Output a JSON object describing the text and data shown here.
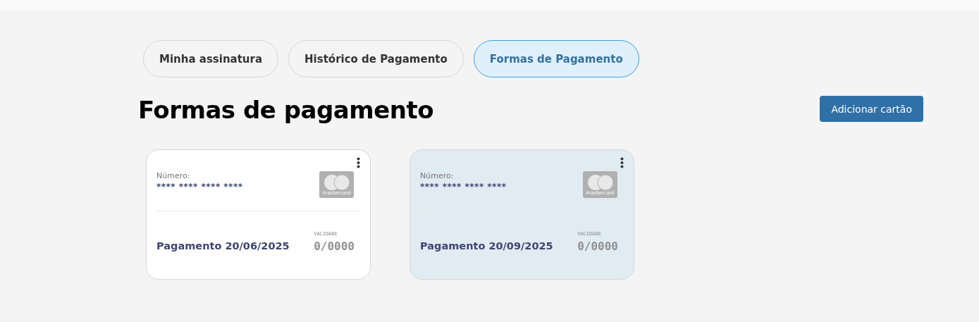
{
  "tabs": [
    {
      "label": "Minha assinatura",
      "selected": false
    },
    {
      "label": "Histórico de Pagamento",
      "selected": false
    },
    {
      "label": "Formas de Pagamento",
      "selected": true
    }
  ],
  "heading": "Formas de pagamento",
  "add_button": "Adicionar cartão",
  "cards": [
    {
      "selected": false,
      "number_label": "Número:",
      "number": "**** **** **** ****",
      "brand": "mastercard",
      "payment": "Pagamento 20/06/2025",
      "validity_label": "VALIDADE",
      "validity": "0/0000"
    },
    {
      "selected": true,
      "number_label": "Número:",
      "number": "**** **** **** ****",
      "brand": "mastercard",
      "payment": "Pagamento 20/09/2025",
      "validity_label": "VALIDADE",
      "validity": "0/0000"
    }
  ]
}
